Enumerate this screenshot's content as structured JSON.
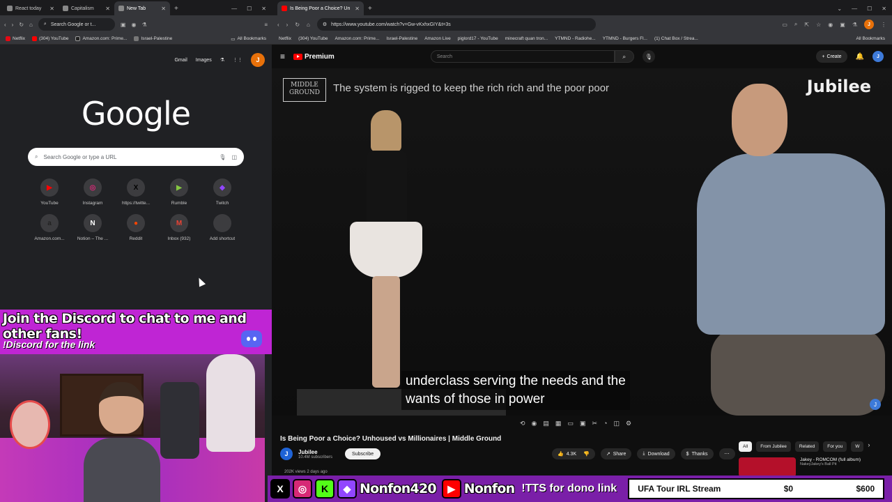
{
  "left_window": {
    "tabs": [
      {
        "label": "React today",
        "active": false
      },
      {
        "label": "Capitalism",
        "active": false
      },
      {
        "label": "New Tab",
        "active": true
      }
    ],
    "omnibox": "Search Google or t...",
    "bookmarks": [
      "Netflix",
      "(304) YouTube",
      "Amazon.com: Prime...",
      "Israel-Palestine",
      "All Bookmarks"
    ],
    "ntp": {
      "top_links": [
        "Gmail",
        "Images"
      ],
      "avatar_letter": "J",
      "logo": "Google",
      "search_placeholder": "Search Google or type a URL",
      "shortcuts": [
        {
          "label": "YouTube",
          "glyph": "▶",
          "color": "#ff0000"
        },
        {
          "label": "Instagram",
          "glyph": "◎",
          "color": "#d62976"
        },
        {
          "label": "https://twitte...",
          "glyph": "X",
          "color": "#000000"
        },
        {
          "label": "Rumble",
          "glyph": "▶",
          "color": "#85c742"
        },
        {
          "label": "Twitch",
          "glyph": "◆",
          "color": "#9146ff"
        },
        {
          "label": "Amazon.com...",
          "glyph": "a",
          "color": "#222222"
        },
        {
          "label": "Notion – The ...",
          "glyph": "N",
          "color": "#ffffff"
        },
        {
          "label": "Reddit",
          "glyph": "●",
          "color": "#ff4500"
        },
        {
          "label": "Inbox (932)",
          "glyph": "M",
          "color": "#ea4335"
        },
        {
          "label": "Add shortcut",
          "glyph": "+",
          "color": "#3c3c3f"
        }
      ]
    }
  },
  "overlay": {
    "discord_line1": "Join the Discord to chat to me and other fans!",
    "discord_line2": "!Discord for the link"
  },
  "right_window": {
    "tab_title": "Is Being Poor a Choice? Un",
    "url": "https://www.youtube.com/watch?v=Gw-vKxhxGIY&t=3s",
    "bookmarks": [
      "Netflix",
      "(304) YouTube",
      "Amazon.com: Prime...",
      "Israel-Palestine",
      "Amazon Live",
      "piglord17 - YouTube",
      "minecraft quan tron...",
      "YTMND - Radiohe...",
      "YTMND - Burgers Fl...",
      "(1) Chat Box / Strea...",
      "All Bookmarks"
    ],
    "yt": {
      "brand": "Premium",
      "search_placeholder": "Search",
      "create_label": "Create",
      "video": {
        "show_logo": "MIDDLE GROUND",
        "topic": "The system is rigged to keep the rich rich and the poor poor",
        "watermark": "Jubilee",
        "caption_line1": "underclass serving the needs and the",
        "caption_line2": "wants of those in power"
      },
      "title": "Is Being Poor a Choice? Unhoused vs Millionaires | Middle Ground",
      "channel": {
        "name": "Jubilee",
        "subs": "10.4M subscribers",
        "subscribe": "Subscribe"
      },
      "actions": {
        "likes": "4.3K",
        "share": "Share",
        "download": "Download",
        "thanks": "Thanks"
      },
      "views": "202K views  2 days ago",
      "chips": [
        "All",
        "From Jubilee",
        "Related",
        "For you",
        "W"
      ],
      "rec": {
        "title": "Jakey - ROMCOM (full album)",
        "channel": "NakeyJakey's Ball Pit"
      }
    }
  },
  "stream_bar": {
    "handle_kick": "Nonfon420",
    "handle_yt": "Nonfon",
    "tts": "!TTS for dono link",
    "goal_label": "UFA Tour IRL Stream",
    "goal_current": "$0",
    "goal_target": "$600"
  }
}
